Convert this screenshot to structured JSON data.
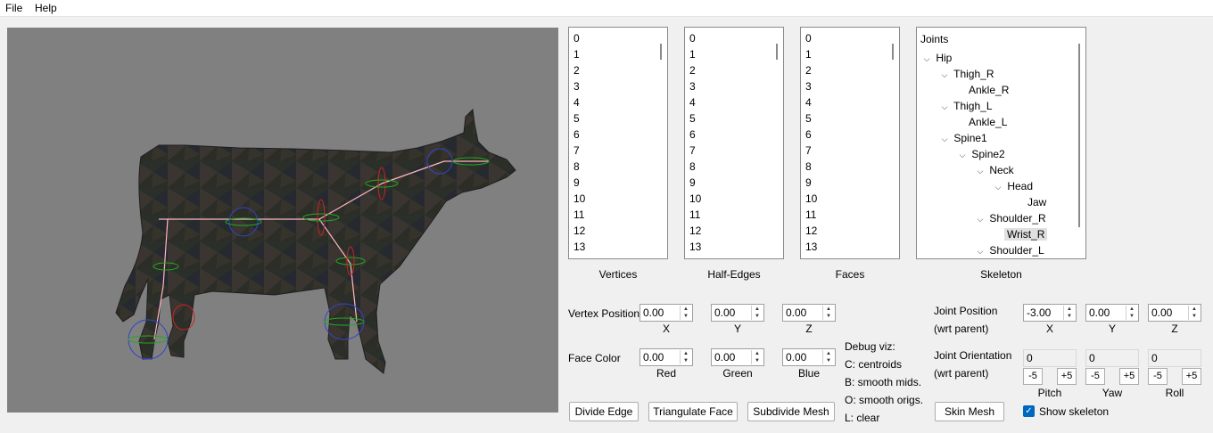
{
  "menu": {
    "file": "File",
    "help": "Help"
  },
  "lists": {
    "vertices": {
      "caption": "Vertices",
      "items": [
        "0",
        "1",
        "2",
        "3",
        "4",
        "5",
        "6",
        "7",
        "8",
        "9",
        "10",
        "11",
        "12",
        "13"
      ]
    },
    "half_edges": {
      "caption": "Half-Edges",
      "items": [
        "0",
        "1",
        "2",
        "3",
        "4",
        "5",
        "6",
        "7",
        "8",
        "9",
        "10",
        "11",
        "12",
        "13"
      ]
    },
    "faces": {
      "caption": "Faces",
      "items": [
        "0",
        "1",
        "2",
        "3",
        "4",
        "5",
        "6",
        "7",
        "8",
        "9",
        "10",
        "11",
        "12",
        "13"
      ]
    }
  },
  "skeleton": {
    "caption": "Skeleton",
    "header": "Joints",
    "nodes": [
      {
        "label": "Hip",
        "depth": 0,
        "expandable": true
      },
      {
        "label": "Thigh_R",
        "depth": 1,
        "expandable": true
      },
      {
        "label": "Ankle_R",
        "depth": 2,
        "expandable": false
      },
      {
        "label": "Thigh_L",
        "depth": 1,
        "expandable": true
      },
      {
        "label": "Ankle_L",
        "depth": 2,
        "expandable": false
      },
      {
        "label": "Spine1",
        "depth": 1,
        "expandable": true
      },
      {
        "label": "Spine2",
        "depth": 2,
        "expandable": true
      },
      {
        "label": "Neck",
        "depth": 3,
        "expandable": true
      },
      {
        "label": "Head",
        "depth": 4,
        "expandable": true
      },
      {
        "label": "Jaw",
        "depth": 5,
        "expandable": false
      },
      {
        "label": "Shoulder_R",
        "depth": 3,
        "expandable": true
      },
      {
        "label": "Wrist_R",
        "depth": 4,
        "expandable": false,
        "selected": true
      },
      {
        "label": "Shoulder_L",
        "depth": 3,
        "expandable": true
      }
    ]
  },
  "vertex_position": {
    "label": "Vertex Position",
    "x": "0.00",
    "y": "0.00",
    "z": "0.00",
    "x_label": "X",
    "y_label": "Y",
    "z_label": "Z"
  },
  "face_color": {
    "label": "Face Color",
    "red": "0.00",
    "green": "0.00",
    "blue": "0.00",
    "red_label": "Red",
    "green_label": "Green",
    "blue_label": "Blue"
  },
  "debug": {
    "title": "Debug viz:",
    "c": "C: centroids",
    "b": "B: smooth mids.",
    "o": "O: smooth origs.",
    "l": "L: clear"
  },
  "buttons": {
    "divide_edge": "Divide Edge",
    "triangulate_face": "Triangulate Face",
    "subdivide_mesh": "Subdivide Mesh",
    "skin_mesh": "Skin Mesh"
  },
  "joint_position": {
    "label": "Joint Position",
    "sublabel": "(wrt parent)",
    "x": "-3.00",
    "y": "0.00",
    "z": "0.00",
    "x_label": "X",
    "y_label": "Y",
    "z_label": "Z"
  },
  "joint_orientation": {
    "label": "Joint Orientation",
    "sublabel": "(wrt parent)",
    "pitch": "0",
    "yaw": "0",
    "roll": "0",
    "pitch_label": "Pitch",
    "yaw_label": "Yaw",
    "roll_label": "Roll",
    "minus": "-5",
    "plus": "+5"
  },
  "show_skeleton": {
    "label": "Show skeleton",
    "checked": true,
    "check_glyph": "✓"
  },
  "icons": {
    "expand": "chevron-down-icon",
    "spin_up": "▲",
    "spin_down": "▼"
  },
  "colors": {
    "viewport_bg": "#808080",
    "skeleton_line": "#ffb6c1",
    "checkbox": "#0067c0"
  }
}
